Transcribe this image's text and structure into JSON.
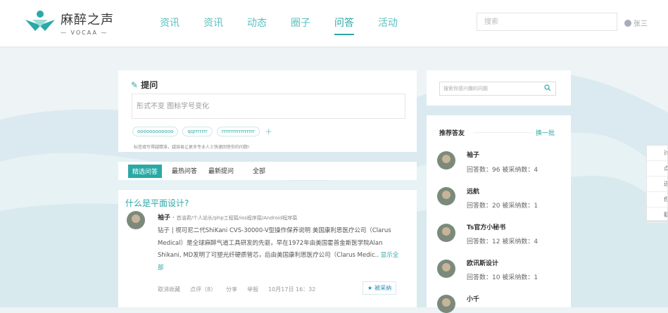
{
  "brand": {
    "name_cn": "麻醉之声",
    "name_en": "VOCAA"
  },
  "nav": {
    "items": [
      "资讯",
      "资讯",
      "动态",
      "圈子",
      "问答",
      "活动"
    ],
    "active_index": 4
  },
  "header": {
    "search_placeholder": "搜索",
    "user_name": "张三"
  },
  "ask": {
    "title": "提问",
    "input_text": "形式不变 图标字号变化",
    "tags": [
      "oooooooooooo",
      "qqrrrrrrr",
      "rrrrrrrrrrrrrrrrr"
    ],
    "add_tag": "+",
    "hint": "标签填写得越精准，越容易让更多专业人士快速回答你的问题!"
  },
  "tabs": {
    "items": [
      "精选问答",
      "最热问答",
      "最新提问",
      "全部"
    ],
    "active_index": 0
  },
  "question": {
    "title": "什么是平面设计?",
    "author": "袖子",
    "author_meta": "首油君/个人站长/php工程猿/ios程序猿/Android程序猿",
    "body": "钻子 | 视可尼二代ShiKani CVS-30000-V型操作保养说明 美国康利思医疗公司（Clarus Medical）是全球麻醉气道工具研发的先驱，早在1972年由美国霍普金斯医学院Alan Shikani, MD发明了可塑光纤硬质管芯，后由美国康利思医疗公司（Clarus Medic..",
    "show_all": "显示全部",
    "actions": [
      "取消收藏",
      "点评（8）",
      "分享",
      "举报",
      "10月17日 16：32"
    ],
    "adopt_label": "被采纳"
  },
  "sidebar": {
    "search_placeholder": "搜索你感兴趣的问题",
    "rec_title": "推荐答友",
    "rec_more": "换一批",
    "answerers": [
      {
        "name": "袖子",
        "stats": "回答数：96    被采纳数：4"
      },
      {
        "name": "远航",
        "stats": "回答数：20    被采纳数：1"
      },
      {
        "name": "Ts官方小秘书",
        "stats": "回答数：12    被采纳数：4"
      },
      {
        "name": "欧讯斯设计",
        "stats": "回答数：10    被采纳数：1"
      },
      {
        "name": "小千",
        "stats": ""
      }
    ]
  },
  "float_panel": {
    "items": [
      "讨",
      "点",
      "送",
      "你",
      "联"
    ]
  },
  "colors": {
    "accent": "#2aa9a6",
    "nav_text": "#5cc0be",
    "link_blue": "#2a8ab5"
  }
}
